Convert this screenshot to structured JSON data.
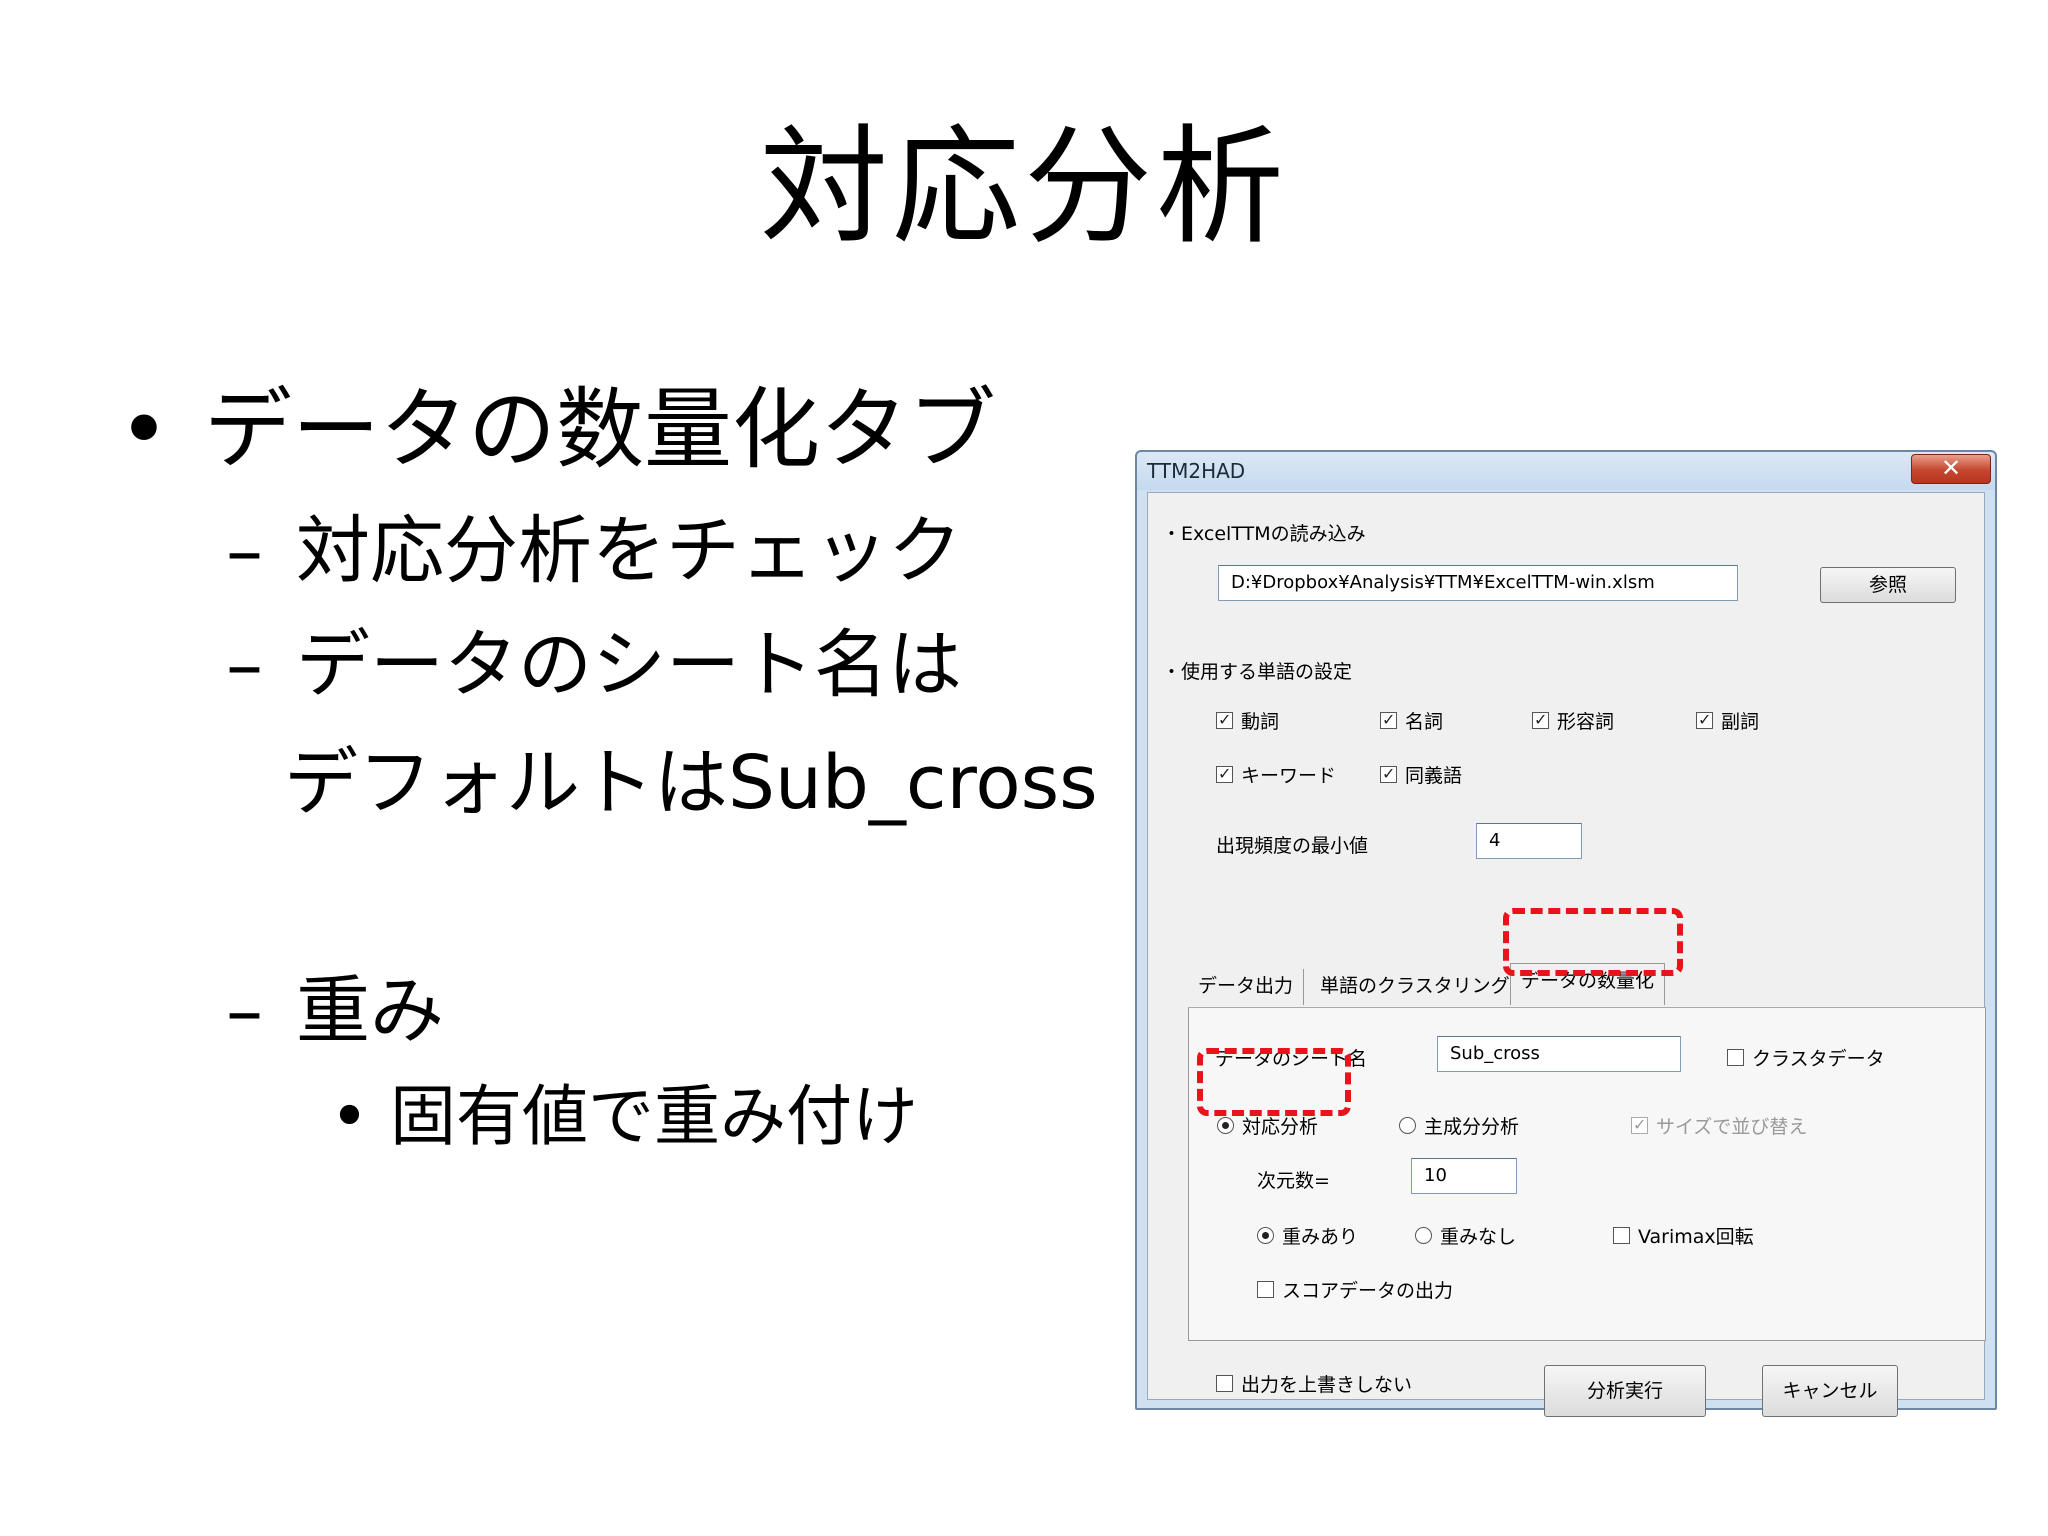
{
  "slide": {
    "title": "対応分析",
    "bullet_main": "データの数量化タブ",
    "sub1": "対応分析をチェック",
    "sub2_line1": "データのシート名は",
    "sub2_line2": "デフォルトはSub_cross",
    "sub3": "重み",
    "subsub1": "固有値で重み付け",
    "bullet_char": "•",
    "dash_char": "–"
  },
  "dialog": {
    "title": "TTM2HAD",
    "close_label": "✕",
    "section_read": "・ExcelTTMの読み込み",
    "file_path": "D:¥Dropbox¥Analysis¥TTM¥ExcelTTM-win.xlsm",
    "browse_label": "参照",
    "section_words": "・使用する単語の設定",
    "word_types": [
      {
        "label": "動詞",
        "checked": true
      },
      {
        "label": "名詞",
        "checked": true
      },
      {
        "label": "形容詞",
        "checked": true
      },
      {
        "label": "副詞",
        "checked": true
      },
      {
        "label": "キーワード",
        "checked": true
      },
      {
        "label": "同義語",
        "checked": true
      }
    ],
    "min_freq_label": "出現頻度の最小値",
    "min_freq_value": "4",
    "tabs": [
      "データ出力",
      "単語のクラスタリング",
      "データの数量化"
    ],
    "sheet_name_label": "データのシート名",
    "sheet_name_value": "Sub_cross",
    "cluster_data_label": "クラスタデータ",
    "correspondence_label": "対応分析",
    "pca_label": "主成分分析",
    "sort_by_size_label": "サイズで並び替え",
    "dims_label": "次元数=",
    "dims_value": "10",
    "weight_on_label": "重みあり",
    "weight_off_label": "重みなし",
    "varimax_label": "Varimax回転",
    "score_output_label": "スコアデータの出力",
    "no_overwrite_label": "出力を上書きしない",
    "run_label": "分析実行",
    "cancel_label": "キャンセル"
  },
  "colors": {
    "highlight": "#e8131b",
    "window_frame": "#cfe0f1"
  }
}
